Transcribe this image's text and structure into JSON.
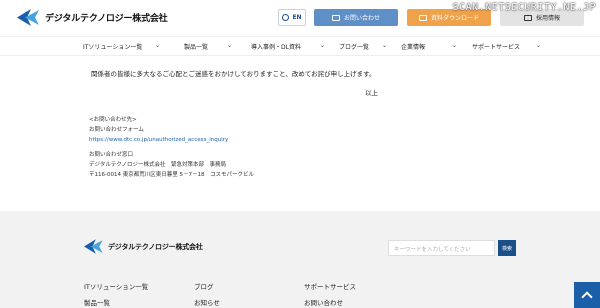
{
  "header": {
    "company_name": "デジタルテクノロジー株式会社",
    "lang_label": "EN",
    "contact_label": "お問い合わせ",
    "docs_label": "資料ダウンロード",
    "recruit_label": "採用情報",
    "watermark": "SCAN.NETSECURITY.NE.JP"
  },
  "nav": {
    "items": [
      "ITソリューション一覧",
      "製品一覧",
      "導入事例・DL資料",
      "ブログ一覧",
      "企業情報",
      "サポートサービス"
    ]
  },
  "content": {
    "paragraph": "関係者の皆様に多大なるご心配とご迷惑をおかけしておりますこと、改めてお詫び申し上げます。",
    "closing": "以上",
    "inquiry_heading": "<お問い合わせ先>",
    "inquiry_form_label": "お問い合わせフォーム",
    "inquiry_url": "https://www.dtc.co.jp/unauthorized_access_inquiry",
    "contact_window_label": "お問い合わせ窓口",
    "contact_dept": "デジタルテクノロジー株式会社　緊急対策本部　事務局",
    "contact_address": "〒116-0014 東京都荒川区東日暮里 5－7－18　コスモパークビル"
  },
  "footer": {
    "company_name": "デジタルテクノロジー株式会社",
    "search_placeholder": "キーワードを入力してください",
    "search_button": "検索",
    "links": [
      "ITソリューション一覧",
      "製品一覧",
      "ブログ",
      "お知らせ",
      "サポートサービス",
      "お問い合わせ"
    ]
  },
  "colors": {
    "brand_blue": "#1b4f8a",
    "contact_button": "#5e8fc7",
    "docs_button": "#f0a24a"
  }
}
